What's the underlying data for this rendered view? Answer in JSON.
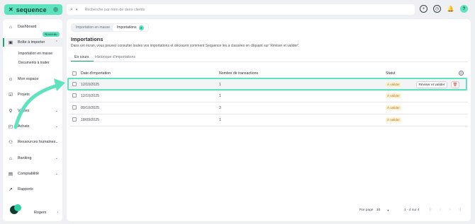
{
  "brand": {
    "name": "sequence",
    "mark": "✕"
  },
  "search": {
    "placeholder": "Recherche par nom de dans clients"
  },
  "header_icons": [
    "plus-circle-icon",
    "clock-icon",
    "bell-icon",
    "help-icon"
  ],
  "help_label": "?",
  "sidebar": {
    "items": [
      {
        "label": "Dashboard",
        "icon": "home-icon"
      },
      {
        "label": "Boîte à importer",
        "icon": "inbox-icon",
        "badge": "Nouveau",
        "active": true
      },
      {
        "label": "Mon espace",
        "icon": "user-icon"
      },
      {
        "label": "Projets",
        "icon": "check-square-icon"
      },
      {
        "label": "Ventes",
        "icon": "tag-icon"
      },
      {
        "label": "Achats",
        "icon": "bag-icon"
      },
      {
        "label": "Ressources humaines",
        "icon": "people-icon"
      },
      {
        "label": "Banking",
        "icon": "bank-icon"
      },
      {
        "label": "Comptabilité",
        "icon": "ledger-icon"
      },
      {
        "label": "Rapports",
        "icon": "chart-icon"
      },
      {
        "label": "Rogers",
        "icon": "avatar-icon"
      }
    ],
    "subitems": [
      "Importation en masse",
      "Documents à traiter"
    ]
  },
  "top_tabs": [
    {
      "label": "Importation en masse"
    },
    {
      "label": "Importations",
      "count": "4",
      "active": true
    }
  ],
  "page": {
    "title": "Importations",
    "description": "Dans cet écran, vous pouvez consulter toutes vos importations et découvrir comment Sequence les a classées en cliquant sur 'Réviser et valider'."
  },
  "sub_tabs": [
    {
      "label": "En cours",
      "active": true
    },
    {
      "label": "Historique d'importations"
    }
  ],
  "table": {
    "columns": [
      "Date d'importation",
      "Nombre de transactions",
      "Statut"
    ],
    "rows": [
      {
        "date": "12/10/2025",
        "count": "1",
        "status": "À valider"
      },
      {
        "date": "12/10/2025",
        "count": "1",
        "status": "À valider"
      },
      {
        "date": "09/10/2025",
        "count": "3",
        "status": "À valider"
      },
      {
        "date": "18/09/2025",
        "count": "1",
        "status": "À valider"
      }
    ],
    "row_actions": {
      "review_label": "Réviser et valider",
      "delete_icon": "trash-icon"
    }
  },
  "pagination": {
    "per_page_label": "Par page",
    "per_page_value": "10",
    "range": "1 - 4 sur 4"
  },
  "colors": {
    "brand": "#5fe3bf",
    "accent": "#1f9e7a",
    "status_bg": "#fdf2d3",
    "status_fg": "#b7791f",
    "danger": "#d14343"
  }
}
